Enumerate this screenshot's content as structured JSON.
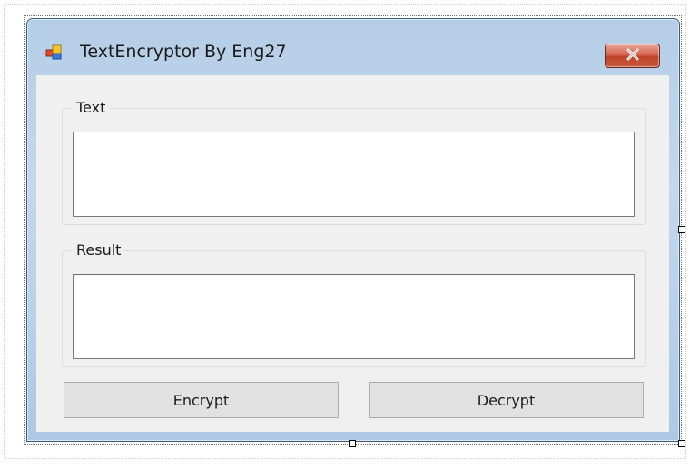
{
  "window": {
    "title": "TextEncryptor By Eng27",
    "close_icon": "close-icon"
  },
  "text_group": {
    "label": "Text",
    "value": ""
  },
  "result_group": {
    "label": "Result",
    "value": ""
  },
  "buttons": {
    "encrypt_label": "Encrypt",
    "decrypt_label": "Decrypt"
  },
  "colors": {
    "client_background": "#f0f0f0",
    "close_button": "#c0432b",
    "window_frame": "#b5cde6"
  }
}
